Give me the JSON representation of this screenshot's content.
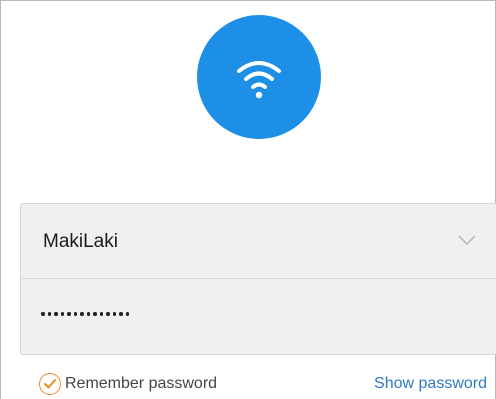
{
  "header": {
    "icon": "wifi-icon",
    "icon_bg_color": "#1e8fe6"
  },
  "form": {
    "username_value": "MakiLaki",
    "password_mask_length": 14,
    "dropdown_icon": "chevron-down-icon"
  },
  "options": {
    "remember_label": "Remember password",
    "remember_checked": true,
    "check_color": "#ef8a1e",
    "show_password_label": "Show password",
    "link_color": "#2f78c5"
  }
}
